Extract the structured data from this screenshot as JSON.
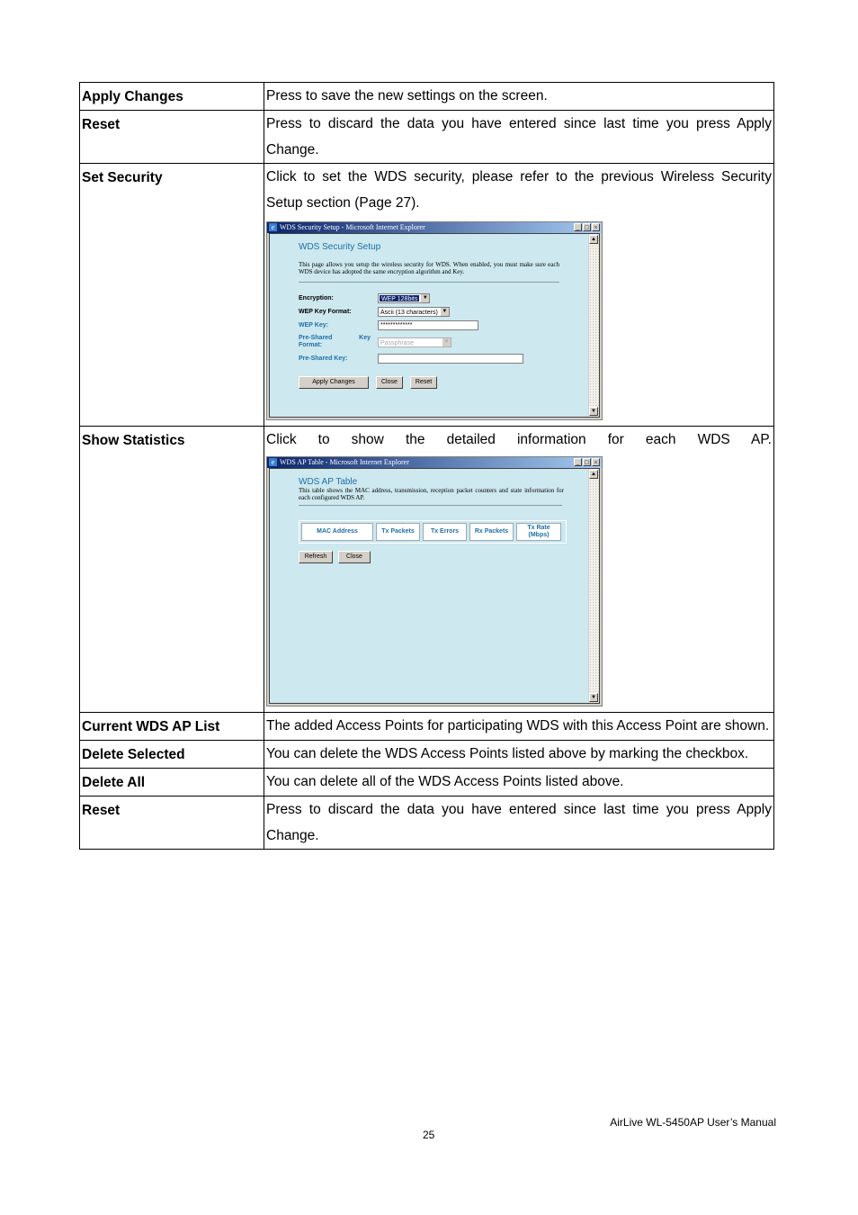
{
  "rows": [
    {
      "term": "Apply Changes",
      "desc": "Press to save the new settings on the screen."
    },
    {
      "term": "Reset",
      "desc": "Press to discard the data you have entered since last time you press Apply Change."
    },
    {
      "term": "Set Security",
      "desc": "Click to set the WDS security, please refer to the previous Wireless Security Setup section (Page 27)."
    },
    {
      "term": "Show Statistics",
      "desc": "Click to show the detailed information for each WDS AP."
    },
    {
      "term": "Current WDS AP List",
      "desc": "The added Access Points for participating WDS with this Access Point are shown."
    },
    {
      "term": "Delete Selected",
      "desc": "You can delete the WDS Access Points listed above by marking the checkbox."
    },
    {
      "term": "Delete All",
      "desc": "You can delete all of the WDS Access Points listed above."
    },
    {
      "term": "Reset",
      "desc": "Press to discard the data you have entered since last time you press Apply Change."
    }
  ],
  "security_window": {
    "window_title": "WDS Security Setup - Microsoft Internet Explorer",
    "heading": "WDS Security Setup",
    "description": "This page allows you setup the wireless security for WDS. When enabled, you must make sure each WDS device has adopted the same encryption algorithm and Key.",
    "fields": {
      "encryption_label": "Encryption:",
      "encryption_value": "WEP 128bits",
      "wep_key_format_label": "WEP Key Format:",
      "wep_key_format_value": "Ascii (13 characters)",
      "wep_key_label": "WEP Key:",
      "wep_key_value": "*************",
      "psk_format_label": "Pre-Shared Key Format:",
      "psk_format_value": "Passphrase",
      "psk_label": "Pre-Shared Key:",
      "psk_value": ""
    },
    "buttons": {
      "apply": "Apply Changes",
      "close": "Close",
      "reset": "Reset"
    }
  },
  "ap_table_window": {
    "window_title": "WDS AP Table - Microsoft Internet Explorer",
    "heading": "WDS AP Table",
    "description": "This table shows the MAC address, transmission, reception packet counters and state information for each configured WDS AP.",
    "columns": [
      "MAC Address",
      "Tx Packets",
      "Tx Errors",
      "Rx Packets",
      "Tx Rate (Mbps)"
    ],
    "buttons": {
      "refresh": "Refresh",
      "close": "Close"
    }
  },
  "window_controls": {
    "minimize": "_",
    "maximize": "□",
    "close": "×"
  },
  "footer": {
    "brand": "AirLive WL-5450AP User’s Manual",
    "page_number": "25"
  }
}
